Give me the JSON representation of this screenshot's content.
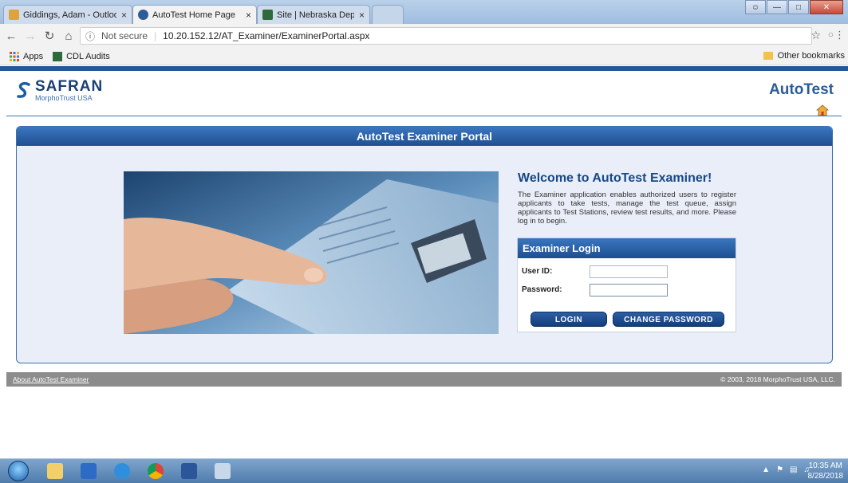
{
  "browser": {
    "tabs": [
      {
        "title": "Giddings, Adam - Outloo",
        "icon": "outlook-icon",
        "color": "#e0a23a"
      },
      {
        "title": "AutoTest Home Page",
        "icon": "autotest-icon",
        "color": "#2c5c98"
      },
      {
        "title": "Site | Nebraska Departme",
        "icon": "nebraska-dmv-icon",
        "color": "#2e6b3a"
      }
    ],
    "close_glyph": "×",
    "security_label": "Not secure",
    "url": "10.20.152.12/AT_Examiner/ExaminerPortal.aspx",
    "bookmarks": [
      {
        "label": "Apps",
        "icon": "apps-grid-icon"
      },
      {
        "label": "CDL Audits",
        "icon": "nebraska-dmv-icon"
      }
    ],
    "other_bookmarks": "Other bookmarks"
  },
  "header": {
    "brand_name": "SAFRAN",
    "brand_sub": "MorphoTrust USA",
    "app_logo": "AutoTest"
  },
  "portal": {
    "title": "AutoTest Examiner Portal",
    "welcome_heading": "Welcome to AutoTest Examiner!",
    "welcome_text": "The Examiner application enables authorized users to register applicants to take tests, manage the test queue, assign applicants to Test Stations, review test results, and more. Please log in to begin.",
    "login": {
      "heading": "Examiner Login",
      "user_id_label": "User ID:",
      "password_label": "Password:",
      "user_id_value": "",
      "password_value": "",
      "login_button": "LOGIN",
      "change_password_button": "CHANGE PASSWORD"
    }
  },
  "footer": {
    "about_link": "About AutoTest Examiner",
    "copyright": "© 2003, 2018 MorphoTrust USA, LLC."
  },
  "taskbar": {
    "apps": [
      "file-explorer-icon",
      "outlook-icon",
      "internet-explorer-icon",
      "chrome-icon",
      "word-icon",
      "paint-icon"
    ],
    "time": "10:35 AM",
    "date": "8/28/2018"
  },
  "colors": {
    "brand_blue": "#1f4f91",
    "panel_bg": "#e9eef8",
    "footer_gray": "#8c8c8c"
  }
}
